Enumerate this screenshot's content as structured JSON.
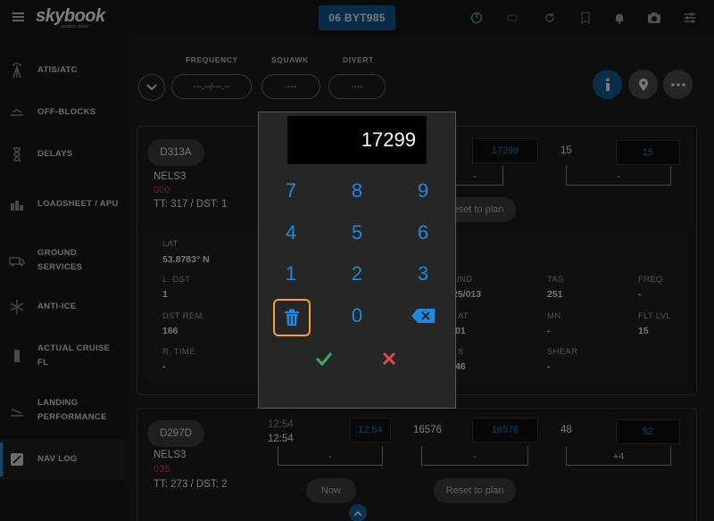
{
  "app": {
    "logo": "skybook",
    "logo_sub": "aviation cloud",
    "flight_button": "06 BYT985"
  },
  "topbar_icons": [
    "menu-icon",
    "power-icon",
    "sync-icon",
    "bookmark-icon",
    "bell-icon",
    "camera-icon",
    "settings-icon"
  ],
  "sidebar": {
    "items": [
      {
        "label": "ATIS/ATC",
        "icon": "antenna-icon"
      },
      {
        "label": "OFF-BLOCKS",
        "icon": "pushback-icon"
      },
      {
        "label": "DELAYS",
        "icon": "hourglass-icon"
      },
      {
        "label": "LOADSHEET / APU",
        "icon": "loadsheet-icon"
      },
      {
        "label": "GROUND SERVICES",
        "icon": "ground-truck-icon"
      },
      {
        "label": "ANTI-ICE",
        "icon": "snowflake-icon"
      },
      {
        "label": "ACTUAL CRUISE FL",
        "icon": "cruise-icon"
      },
      {
        "label": "LANDING PERFORMANCE",
        "icon": "landing-icon"
      },
      {
        "label": "NAV LOG",
        "icon": "navlog-icon"
      }
    ]
  },
  "header": {
    "frequency_label": "FREQUENCY",
    "frequency_value": "---.--/---.--",
    "squawk_label": "SQUAWK",
    "squawk_value": "----",
    "divert_label": "DIVERT",
    "divert_value": "----"
  },
  "cards": [
    {
      "waypoint": "D313A",
      "name": "NELS3",
      "heading": "000",
      "tt_dst": "TT: 317 / DST: 1",
      "fuel_box": "17299",
      "fuel_value": "15",
      "fuel_box2": "15",
      "bracket1": "-",
      "bracket2": "-",
      "reset_label": "Reset to plan",
      "details": {
        "lat_label": "LAT",
        "lat_value": "53.8783° N",
        "l_dst_label": "L. DST",
        "l_dst_value": "1",
        "dst_rem_label": "DST REM.",
        "dst_rem_value": "166",
        "r_time_label": "R. TIME",
        "r_time_value": "-",
        "wind_label": "IND",
        "wind_value": "25/013",
        "tas_label": "TAS",
        "tas_value": "251",
        "freq_label": "FREQ",
        "freq_value": "-",
        "at_label": "AT",
        "at_value": "01",
        "mn_label": "MN",
        "mn_value": "-",
        "fl_label": "FLT LVL",
        "fl_value": "15",
        "s_label": "S",
        "s_value": "46",
        "shear_label": "SHEAR",
        "shear_value": "-"
      }
    },
    {
      "waypoint": "D297D",
      "name": "NELS3",
      "heading": "035",
      "tt_dst": "TT: 273 / DST: 2",
      "time_top": "12:54",
      "time_main": "12:54",
      "time_box": "12:54",
      "fuel_value": "16576",
      "fuel_box": "16576",
      "level_value": "48",
      "level_box": "52",
      "bracket1": "-",
      "bracket2": "-",
      "bracket3": "+4",
      "now_label": "Now",
      "reset_label": "Reset to plan"
    }
  ],
  "keypad": {
    "display": "17299",
    "keys": [
      "7",
      "8",
      "9",
      "4",
      "5",
      "6",
      "1",
      "2",
      "3",
      "0"
    ],
    "clear_icon": "trash-icon",
    "backspace_icon": "backspace-icon",
    "confirm_icon": "check-icon",
    "cancel_icon": "x-icon"
  },
  "colors": {
    "accent_blue": "#1d8ae0",
    "focus_orange": "#f2a23a",
    "confirm_green": "#3cae5a",
    "cancel_red": "#e04a4a"
  }
}
